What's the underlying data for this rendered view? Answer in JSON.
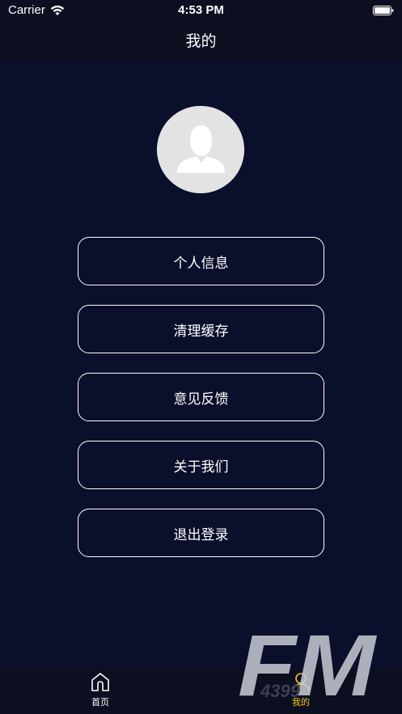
{
  "status_bar": {
    "carrier": "Carrier",
    "time": "4:53 PM",
    "wifi_icon": "wifi-icon",
    "battery_icon": "battery-icon"
  },
  "nav": {
    "title": "我的"
  },
  "avatar": {
    "icon": "user-avatar-icon"
  },
  "menu": {
    "items": [
      {
        "label": "个人信息"
      },
      {
        "label": "清理缓存"
      },
      {
        "label": "意见反馈"
      },
      {
        "label": "关于我们"
      },
      {
        "label": "退出登录"
      }
    ]
  },
  "tab_bar": {
    "tabs": [
      {
        "label": "首页",
        "icon": "home-icon",
        "active": false
      },
      {
        "label": "我的",
        "icon": "user-icon",
        "active": true
      }
    ],
    "active_color": "#f5c518",
    "inactive_color": "#ffffff"
  },
  "watermark": {
    "text_main": "FM",
    "text_sub": "4399"
  },
  "colors": {
    "background": "#0a0f2b",
    "bar_background": "#0c0f20"
  }
}
